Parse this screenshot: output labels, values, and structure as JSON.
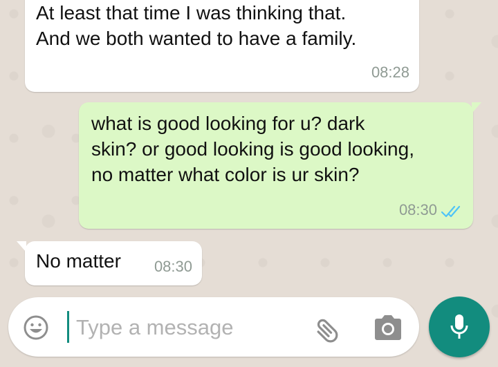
{
  "messages": [
    {
      "direction": "incoming",
      "text": "At least that time I was thinking that.\nAnd we both wanted to have a family.",
      "time": "08:28"
    },
    {
      "direction": "outgoing",
      "text": "what is good looking for u? dark\nskin? or good looking is good looking,\nno matter what color is ur skin?",
      "time": "08:30",
      "status": "read",
      "status_icon": "double-check-icon",
      "status_color": "#4fc3f7"
    },
    {
      "direction": "incoming",
      "text": "No matter",
      "time": "08:30"
    }
  ],
  "composer": {
    "placeholder": "Type a message",
    "value": "",
    "emoji_icon": "emoji-icon",
    "attach_icon": "paperclip-icon",
    "camera_icon": "camera-icon",
    "send_icon": "microphone-icon"
  },
  "colors": {
    "chat_background": "#e5ddd5",
    "incoming_bubble": "#ffffff",
    "outgoing_bubble": "#dcf8c6",
    "accent": "#128c7e",
    "timestamp": "#8f9a93"
  }
}
